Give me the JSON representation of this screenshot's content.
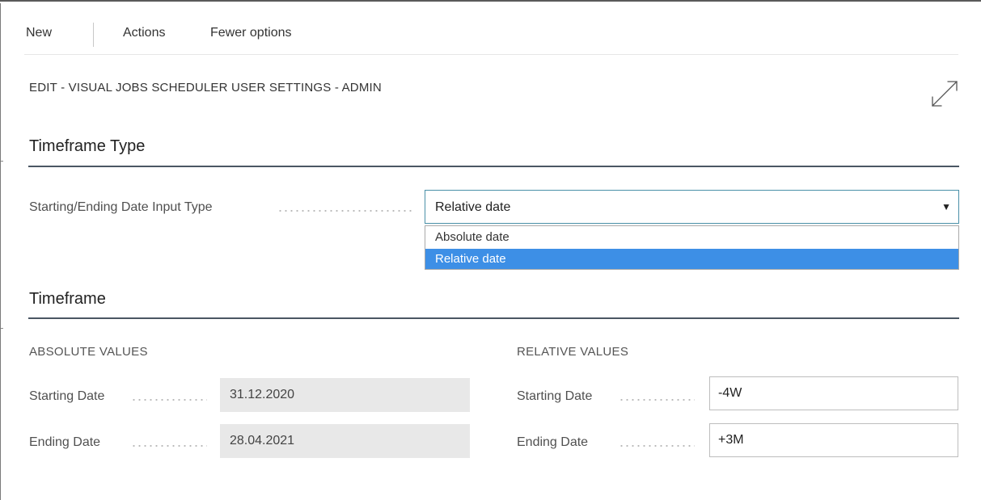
{
  "toolbar": {
    "new_label": "New",
    "actions_label": "Actions",
    "fewer_options_label": "Fewer options"
  },
  "page": {
    "title": "EDIT - VISUAL JOBS SCHEDULER USER SETTINGS - ADMIN",
    "expand_icon": "expand-diagonal-arrows-icon"
  },
  "timeframe_type": {
    "section_title": "Timeframe Type",
    "input_type_label": "Starting/Ending Date Input Type",
    "input_type_value": "Relative date",
    "options": [
      "Absolute date",
      "Relative date"
    ],
    "selected_option": "Relative date"
  },
  "timeframe": {
    "section_title": "Timeframe",
    "absolute": {
      "group_title": "ABSOLUTE VALUES",
      "starting_date_label": "Starting Date",
      "starting_date_value": "31.12.2020",
      "ending_date_label": "Ending Date",
      "ending_date_value": "28.04.2021"
    },
    "relative": {
      "group_title": "RELATIVE VALUES",
      "starting_date_label": "Starting Date",
      "starting_date_value": "-4W",
      "ending_date_label": "Ending Date",
      "ending_date_value": "+3M"
    }
  },
  "colors": {
    "accent_border": "#4a90a8",
    "selected_option_bg": "#3d8fe6",
    "section_rule": "#4a5663",
    "readonly_field_bg": "#e8e8e8"
  }
}
